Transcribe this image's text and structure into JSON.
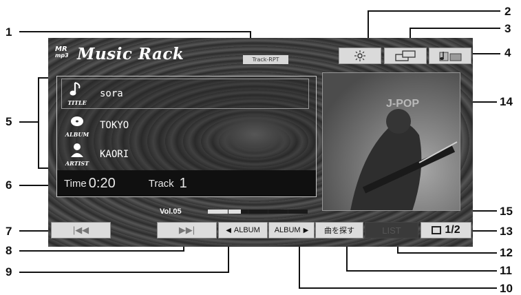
{
  "callouts": [
    "1",
    "2",
    "3",
    "4",
    "5",
    "6",
    "7",
    "8",
    "9",
    "10",
    "11",
    "12",
    "13",
    "14",
    "15"
  ],
  "header": {
    "brand_mr": "MR",
    "brand_mp3": "mp3",
    "brand_title": "Music Rack",
    "track_rpt": "Track-RPT"
  },
  "icons": {
    "sun": "brightness-icon",
    "screens": "screen-mode-icon",
    "music": "music-mode-icon"
  },
  "info": {
    "title_label": "TITLE",
    "title": "sora",
    "album_label": "ALBUM",
    "album": "TOKYO",
    "artist_label": "ARTIST",
    "artist": "KAORI",
    "time_label": "Time",
    "time": "0:20",
    "track_label": "Track",
    "track": "1"
  },
  "artwork": {
    "text": "J-POP"
  },
  "volume": {
    "label": "Vol.05",
    "level": 5,
    "max": 15
  },
  "controls": {
    "prev": "|◀◀",
    "next": "▶▶|",
    "album_prev": "ALBUM",
    "album_next": "ALBUM",
    "search": "曲を探す",
    "list": "LIST",
    "page": "1/2"
  },
  "colors": {
    "screen_bg": "#3a3a3a",
    "button_bg": "#dcdcdc",
    "time_bar": "#101010"
  }
}
